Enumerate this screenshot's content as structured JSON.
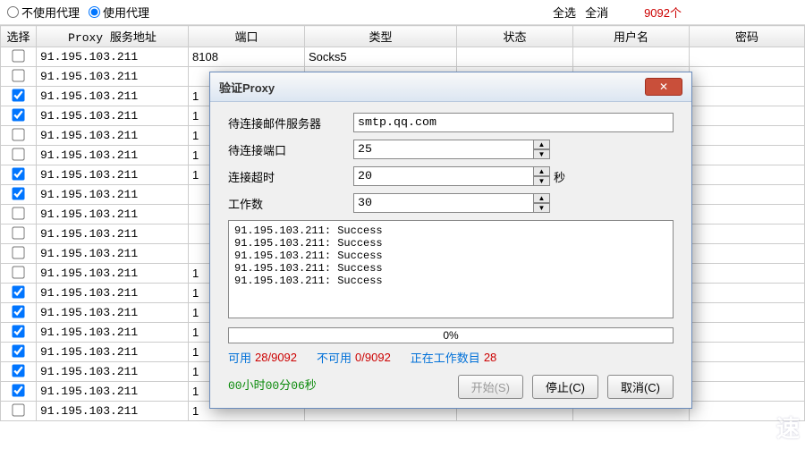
{
  "topbar": {
    "noproxy": "不使用代理",
    "useproxy": "使用代理",
    "selectall": "全选",
    "deselectall": "全消",
    "count": "9092个"
  },
  "columns": {
    "sel": "选择",
    "addr": "Proxy 服务地址",
    "port": "端口",
    "type": "类型",
    "status": "状态",
    "user": "用户名",
    "pwd": "密码"
  },
  "rows": [
    {
      "checked": false,
      "addr": "91.195.103.211",
      "port": "8108",
      "type": "Socks5",
      "status": ""
    },
    {
      "checked": false,
      "addr": "91.195.103.211",
      "port": "",
      "type": "",
      "status": ""
    },
    {
      "checked": true,
      "addr": "91.195.103.211",
      "port": "1",
      "type": "",
      "status": ""
    },
    {
      "checked": true,
      "addr": "91.195.103.211",
      "port": "1",
      "type": "",
      "status": ""
    },
    {
      "checked": false,
      "addr": "91.195.103.211",
      "port": "1",
      "type": "",
      "status": ""
    },
    {
      "checked": false,
      "addr": "91.195.103.211",
      "port": "1",
      "type": "",
      "status": ""
    },
    {
      "checked": true,
      "addr": "91.195.103.211",
      "port": "1",
      "type": "",
      "status": ""
    },
    {
      "checked": true,
      "addr": "91.195.103.211",
      "port": "",
      "type": "",
      "status": ""
    },
    {
      "checked": false,
      "addr": "91.195.103.211",
      "port": "",
      "type": "",
      "status": ""
    },
    {
      "checked": false,
      "addr": "91.195.103.211",
      "port": "",
      "type": "",
      "status": ""
    },
    {
      "checked": false,
      "addr": "91.195.103.211",
      "port": "",
      "type": "",
      "status": ""
    },
    {
      "checked": false,
      "addr": "91.195.103.211",
      "port": "1",
      "type": "",
      "status": ""
    },
    {
      "checked": true,
      "addr": "91.195.103.211",
      "port": "1",
      "type": "",
      "status": ""
    },
    {
      "checked": true,
      "addr": "91.195.103.211",
      "port": "1",
      "type": "",
      "status": ""
    },
    {
      "checked": true,
      "addr": "91.195.103.211",
      "port": "1",
      "type": "",
      "status": ""
    },
    {
      "checked": true,
      "addr": "91.195.103.211",
      "port": "1",
      "type": "",
      "status": ""
    },
    {
      "checked": true,
      "addr": "91.195.103.211",
      "port": "1",
      "type": "",
      "status": ""
    },
    {
      "checked": true,
      "addr": "91.195.103.211",
      "port": "1",
      "type": "",
      "status": ""
    },
    {
      "checked": false,
      "addr": "91.195.103.211",
      "port": "1",
      "type": "",
      "status": ""
    }
  ],
  "dialog": {
    "title": "验证Proxy",
    "fields": {
      "server_lbl": "待连接邮件服务器",
      "server_val": "smtp.qq.com",
      "port_lbl": "待连接端口",
      "port_val": "25",
      "timeout_lbl": "连接超时",
      "timeout_val": "20",
      "timeout_unit": "秒",
      "workers_lbl": "工作数",
      "workers_val": "30"
    },
    "log": "91.195.103.211: Success\n91.195.103.211: Success\n91.195.103.211: Success\n91.195.103.211: Success\n91.195.103.211: Success",
    "progress": "0%",
    "stats": {
      "avail_lbl": "可用",
      "avail_val": "28/9092",
      "unavail_lbl": "不可用",
      "unavail_val": "0/9092",
      "working_lbl": "正在工作数目",
      "working_val": "28",
      "timer": "00小时00分06秒"
    },
    "buttons": {
      "start": "开始(S)",
      "stop": "停止(C)",
      "cancel": "取消(C)"
    }
  },
  "watermark": "速"
}
